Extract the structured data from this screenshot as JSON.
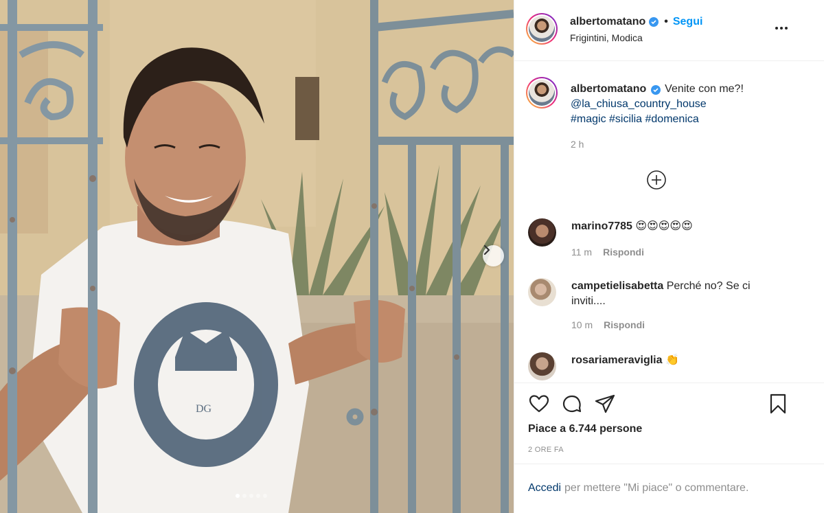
{
  "header": {
    "username": "albertomatano",
    "separator": "•",
    "follow_label": "Segui",
    "location": "Frigintini, Modica"
  },
  "caption": {
    "username": "albertomatano",
    "text": "Venite con me?!",
    "mention": "@la_chiusa_country_house",
    "hashtags": [
      "#magic",
      "#sicilia",
      "#domenica"
    ],
    "time": "2 h"
  },
  "comments": [
    {
      "username": "marino7785",
      "text": "😍😍😍😍😍",
      "time": "11 m",
      "reply_label": "Rispondi"
    },
    {
      "username": "campetielisabetta",
      "text": "Perché no? Se ci inviti....",
      "time": "10 m",
      "reply_label": "Rispondi"
    },
    {
      "username": "rosariameraviglia",
      "text": "👏",
      "time": "",
      "reply_label": ""
    }
  ],
  "actions": {
    "likes_text": "Piace a 6.744 persone",
    "time_ago": "2 ORE FA"
  },
  "login": {
    "link_label": "Accedi",
    "rest_text": "per mettere \"Mi piace\" o commentare."
  },
  "carousel": {
    "slide_count": 5,
    "active_index": 0
  },
  "colors": {
    "accent": "#0095f6",
    "link": "#00376b",
    "muted": "#8e8e8e",
    "verified": "#3897f0"
  },
  "icons": [
    "verified-icon",
    "more-options-icon",
    "load-more-icon",
    "heart-icon",
    "comment-icon",
    "share-icon",
    "save-icon",
    "chevron-right-icon"
  ]
}
